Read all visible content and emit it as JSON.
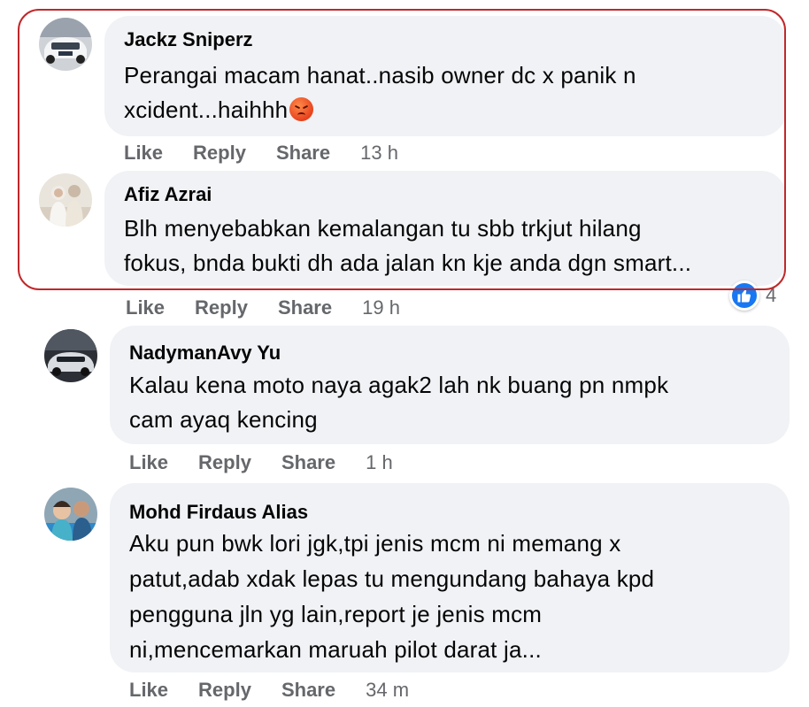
{
  "comments": [
    {
      "author": "Jackz Sniperz",
      "text_lines": [
        "Perangai macam hanat..nasib owner dc x panik n",
        "xcident...haihhh"
      ],
      "emoji": "angry-face-icon",
      "actions": {
        "like": "Like",
        "reply": "Reply",
        "share": "Share"
      },
      "time": "13 h"
    },
    {
      "author": "Afiz Azrai",
      "text_lines": [
        "Blh menyebabkan kemalangan tu sbb trkjut hilang",
        "fokus, bnda bukti dh ada jalan kn kje anda dgn smart..."
      ],
      "actions": {
        "like": "Like",
        "reply": "Reply",
        "share": "Share"
      },
      "time": "19 h",
      "reactions": {
        "icon": "like-thumb-icon",
        "count": "4"
      }
    },
    {
      "author": "NadymanAvy Yu",
      "text_lines": [
        "Kalau kena moto naya agak2 lah nk buang pn nmpk",
        "cam ayaq kencing"
      ],
      "actions": {
        "like": "Like",
        "reply": "Reply",
        "share": "Share"
      },
      "time": "1 h"
    },
    {
      "author": "Mohd Firdaus Alias",
      "text_lines": [
        "Aku pun bwk lori jgk,tpi jenis mcm ni memang x",
        "patut,adab xdak lepas tu mengundang bahaya kpd",
        "pengguna jln yg lain,report je jenis mcm",
        "ni,mencemarkan maruah pilot darat ja..."
      ],
      "actions": {
        "like": "Like",
        "reply": "Reply",
        "share": "Share"
      },
      "time": "34 m"
    }
  ],
  "colors": {
    "bubble": "#f0f2f5",
    "meta_text": "#65676b",
    "highlight_border": "#c0282a",
    "like_blue": "#1877f2"
  }
}
